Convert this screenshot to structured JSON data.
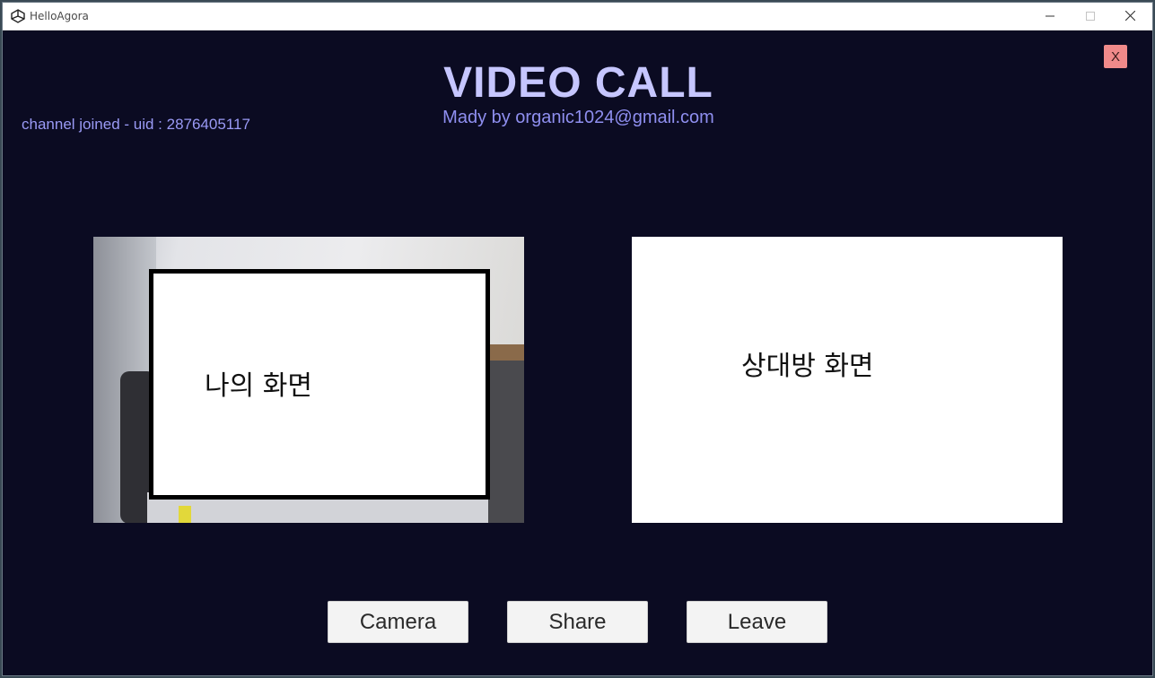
{
  "window": {
    "title": "HelloAgora",
    "app_icon": "unity-icon",
    "controls": {
      "minimize_icon": "minimize-icon",
      "maximize_icon": "maximize-icon",
      "close_icon": "close-icon"
    }
  },
  "header": {
    "title": "VIDEO CALL",
    "subtitle": "Mady by organic1024@gmail.com",
    "close_label": "X"
  },
  "status": {
    "text": "channel joined - uid : 2876405117"
  },
  "views": {
    "local_label": "나의 화면",
    "remote_label": "상대방 화면"
  },
  "buttons": {
    "camera": "Camera",
    "share": "Share",
    "leave": "Leave"
  },
  "colors": {
    "background": "#0b0b22",
    "title": "#c6c6ff",
    "subtitle": "#8f8ff0",
    "status": "#9a9af5",
    "close_button": "#f08a8a"
  }
}
